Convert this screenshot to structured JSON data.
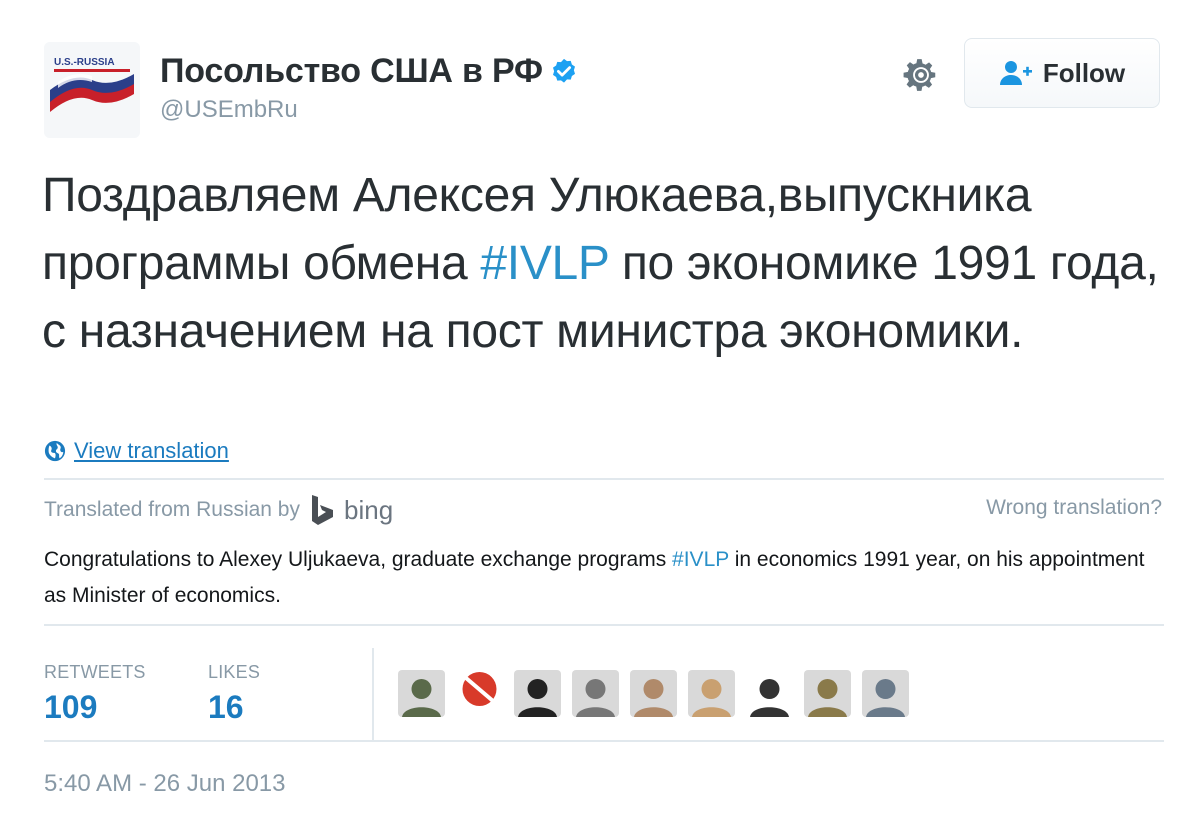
{
  "header": {
    "display_name": "Посольство США в РФ",
    "handle": "@USEmbRu",
    "avatar_text": "U.S.-RUSSIA",
    "follow_label": "Follow"
  },
  "tweet": {
    "text_before_hashtag": "Поздравляем Алексея Улюкаева,выпускника программы обмена ",
    "hashtag": "#IVLP",
    "text_after_hashtag": " по экономике 1991 года, с назначением на пост министра экономики."
  },
  "translation": {
    "view_label": "View translation",
    "translated_from": "Translated from Russian by",
    "provider": "bing",
    "wrong_label": "Wrong translation?",
    "text_before_hashtag": "Congratulations to Alexey Uljukaeva, graduate exchange programs ",
    "hashtag": "#IVLP",
    "text_after_hashtag": " in economics 1991 year, on his appointment as Minister of economics."
  },
  "stats": {
    "retweets_label": "RETWEETS",
    "retweets_value": "109",
    "likes_label": "LIKES",
    "likes_value": "16"
  },
  "likers": [
    {
      "icon": "avatar-tattoo",
      "color": "#5a6a4a"
    },
    {
      "icon": "avatar-ghostbusters",
      "color": "#d83a2a"
    },
    {
      "icon": "avatar-sketch-face",
      "color": "#222222"
    },
    {
      "icon": "avatar-bw-photo",
      "color": "#777777"
    },
    {
      "icon": "avatar-couple",
      "color": "#b08a6a"
    },
    {
      "icon": "avatar-blonde",
      "color": "#c9a070"
    },
    {
      "icon": "avatar-batman",
      "color": "#333333"
    },
    {
      "icon": "avatar-uniform",
      "color": "#8a7a4a"
    },
    {
      "icon": "avatar-man-suit",
      "color": "#6a7a8a"
    }
  ],
  "timestamp": "5:40 AM - 26 Jun 2013",
  "colors": {
    "link": "#1b7bbf",
    "hashtag": "#2a90c8",
    "muted": "#8899a6",
    "verified": "#1da1f2"
  }
}
